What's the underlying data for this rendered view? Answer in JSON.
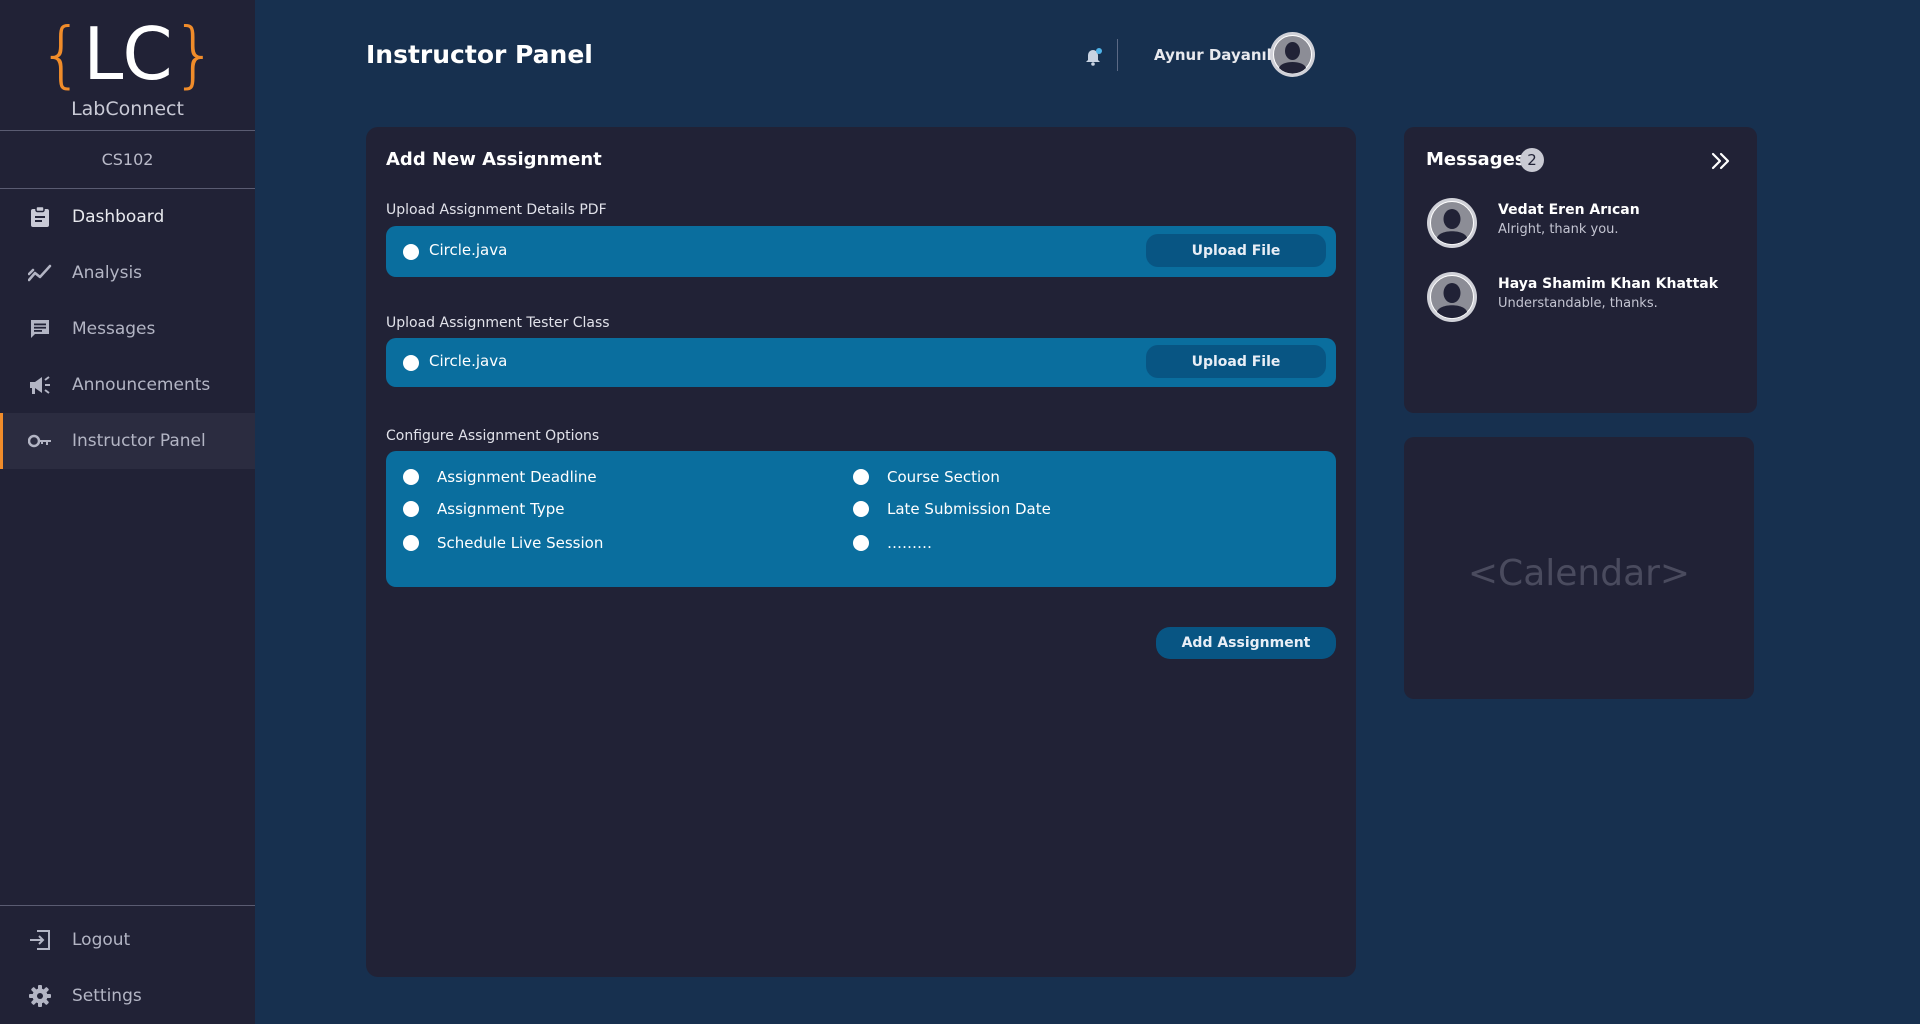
{
  "brand": {
    "logo_open": "{",
    "logo_letters": "LC",
    "logo_close": "}",
    "name": "LabConnect",
    "accent_color": "#f08c2a"
  },
  "sidebar": {
    "course": "CS102",
    "items": [
      {
        "label": "Dashboard",
        "icon": "clipboard-icon"
      },
      {
        "label": "Analysis",
        "icon": "trend-chart-icon"
      },
      {
        "label": "Messages",
        "icon": "chat-icon"
      },
      {
        "label": "Announcements",
        "icon": "megaphone-icon"
      },
      {
        "label": "Instructor Panel",
        "icon": "key-icon",
        "active": true
      }
    ],
    "bottom_items": [
      {
        "label": "Logout",
        "icon": "logout-icon"
      },
      {
        "label": "Settings",
        "icon": "gear-icon"
      }
    ]
  },
  "header": {
    "title": "Instructor Panel",
    "user_name": "Aynur Dayanık"
  },
  "assignment": {
    "title": "Add New Assignment",
    "pdf_label": "Upload Assignment Details PDF",
    "pdf_file": "Circle.java",
    "tester_label": "Upload Assignment Tester Class",
    "tester_file": "Circle.java",
    "upload_button": "Upload File",
    "options_label": "Configure Assignment Options",
    "options_left": [
      "Assignment Deadline",
      "Assignment Type",
      "Schedule Live Session"
    ],
    "options_right": [
      "Course Section",
      "Late Submission Date",
      "………"
    ],
    "add_button": "Add Assignment"
  },
  "messages": {
    "title": "Messages",
    "count": "2",
    "items": [
      {
        "sender": "Vedat Eren Arıcan",
        "preview": "Alright, thank you."
      },
      {
        "sender": "Haya Shamim Khan Khattak",
        "preview": "Understandable, thanks."
      }
    ]
  },
  "calendar": {
    "placeholder": "<Calendar>"
  },
  "colors": {
    "background": "#17304f",
    "panel": "#212236",
    "field": "#0a6e9e",
    "button": "#085583"
  }
}
